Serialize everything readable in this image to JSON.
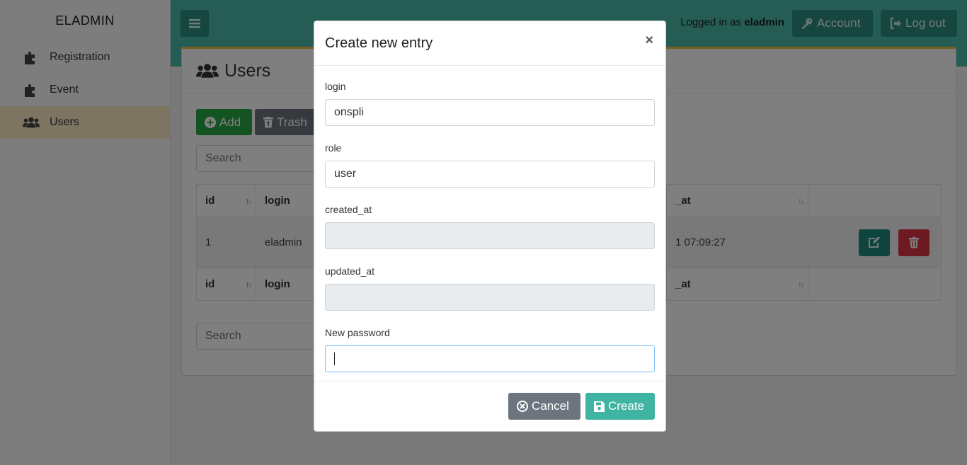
{
  "sidebar": {
    "brand": "ELADMIN",
    "items": [
      {
        "label": "Registration",
        "icon": "puzzle-icon"
      },
      {
        "label": "Event",
        "icon": "puzzle-icon"
      },
      {
        "label": "Users",
        "icon": "users-icon",
        "active": true
      }
    ]
  },
  "topbar": {
    "logged_prefix": "Logged in as",
    "username": "eladmin",
    "account_label": "Account",
    "logout_label": "Log out"
  },
  "page": {
    "title": "Users",
    "add_label": "Add",
    "trash_label": "Trash",
    "search_placeholder": "Search",
    "table": {
      "headers": [
        "id",
        "login",
        "_at"
      ],
      "rows": [
        {
          "id": "1",
          "login": "eladmin",
          "updated_at": "1 07:09:27"
        }
      ]
    }
  },
  "modal": {
    "title": "Create new entry",
    "close": "×",
    "fields": [
      {
        "label": "login",
        "value": "onspli"
      },
      {
        "label": "role",
        "value": "user"
      },
      {
        "label": "created_at",
        "value": ""
      },
      {
        "label": "updated_at",
        "value": ""
      },
      {
        "label": "New password",
        "value": ""
      }
    ],
    "cancel_label": "Cancel",
    "create_label": "Create"
  },
  "colors": {
    "topbar": "#4bbbaa",
    "accent_dark": "#2a8c7f",
    "add": "#28a745",
    "danger": "#dc3545",
    "secondary": "#6c757d",
    "active_nav": "#fbe9c5"
  }
}
